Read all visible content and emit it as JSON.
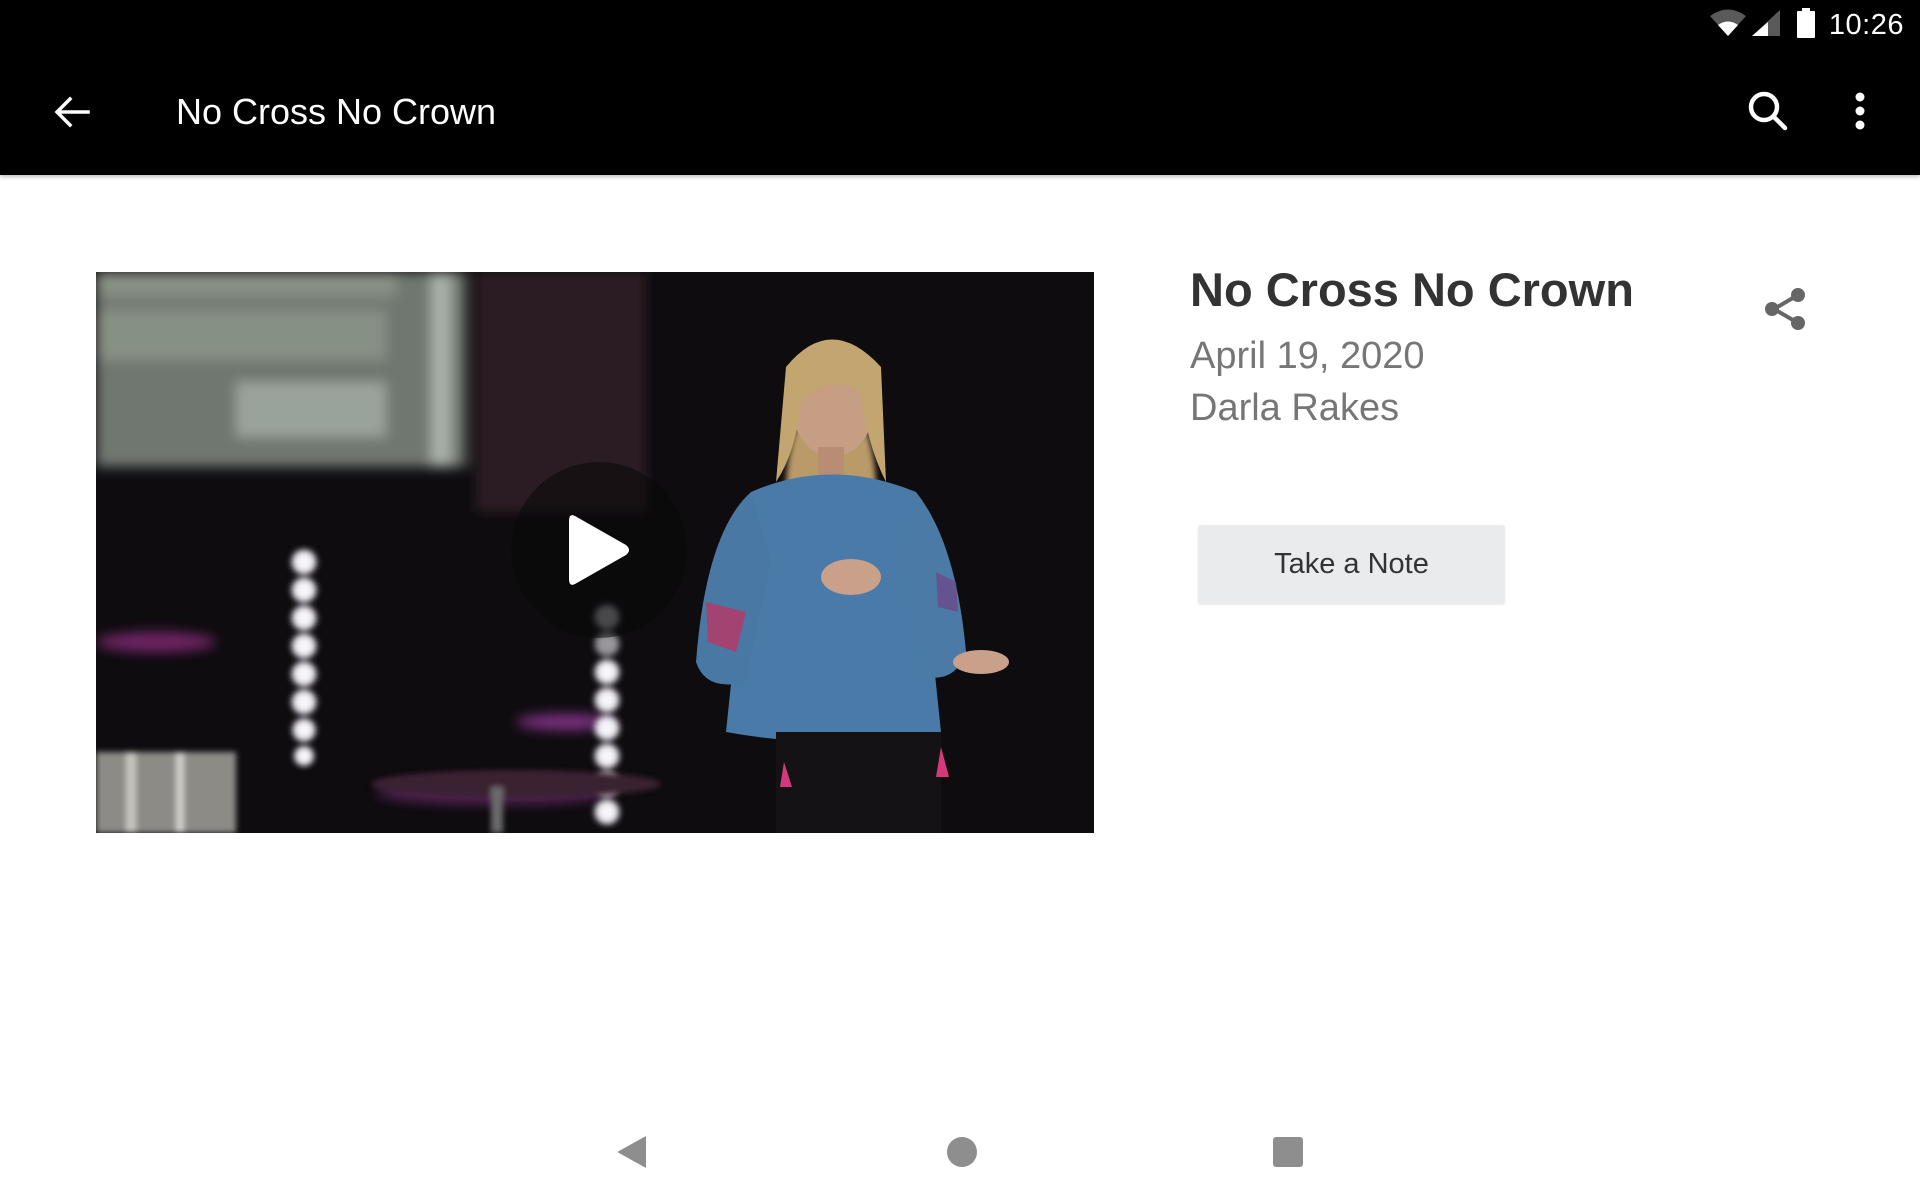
{
  "status_bar": {
    "time": "10:26",
    "icons": [
      "wifi-icon",
      "cell-signal-icon",
      "battery-icon"
    ]
  },
  "app_bar": {
    "title": "No Cross No Crown",
    "back_icon": "arrow-back-icon",
    "actions": [
      "search-icon",
      "more-vert-icon"
    ]
  },
  "media": {
    "thumbnail_description": "Speaker on stage in blue blouse with stage lights",
    "play_icon": "play-icon"
  },
  "details": {
    "title": "No Cross No Crown",
    "date": "April 19, 2020",
    "speaker": "Darla Rakes",
    "share_icon": "share-icon"
  },
  "actions": {
    "take_note_label": "Take a Note"
  },
  "nav_bar": {
    "buttons": [
      "nav-back-icon",
      "nav-home-icon",
      "nav-recents-icon"
    ]
  },
  "colors": {
    "app_bar_bg": "#000000",
    "title_text": "#333333",
    "meta_text": "#767676",
    "button_bg": "#e9ebed",
    "icon_grey": "#666666",
    "nav_icon": "#8e8e8e"
  }
}
